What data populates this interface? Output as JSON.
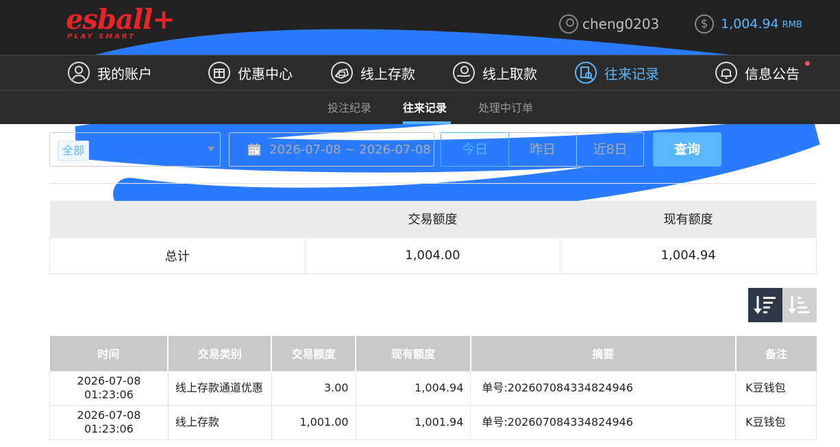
{
  "header": {
    "logo_brand": "esball+",
    "logo_tagline": "PLAY SMART",
    "username": "cheng0203",
    "balance": "1,004.94",
    "currency": "RMB"
  },
  "main_nav": [
    {
      "label": "我的账户",
      "icon": "user-icon"
    },
    {
      "label": "优惠中心",
      "icon": "gift-icon"
    },
    {
      "label": "线上存款",
      "icon": "deposit-icon"
    },
    {
      "label": "线上取款",
      "icon": "withdraw-icon"
    },
    {
      "label": "往来记录",
      "icon": "records-icon",
      "active": true
    },
    {
      "label": "信息公告",
      "icon": "bell-icon"
    }
  ],
  "sub_nav": [
    {
      "label": "投注纪录"
    },
    {
      "label": "往来记录",
      "active": true
    },
    {
      "label": "处理中订单"
    }
  ],
  "filters": {
    "type_selected": "全部",
    "date_range": "2026-07-08 ~ 2026-07-08",
    "ranges": [
      "今日",
      "昨日",
      "近8日"
    ],
    "active_range": "今日",
    "query_label": "查询"
  },
  "summary": {
    "headers": [
      "",
      "交易额度",
      "现有额度"
    ],
    "row": [
      "总计",
      "1,004.00",
      "1,004.94"
    ]
  },
  "records": {
    "headers": [
      "时间",
      "交易类别",
      "交易额度",
      "现有额度",
      "摘要",
      "备注"
    ],
    "rows": [
      [
        "2026-07-08 01:23:06",
        "线上存款通道优惠",
        "3.00",
        "1,004.94",
        "单号:202607084334824946",
        "K豆钱包"
      ],
      [
        "2026-07-08 01:23:06",
        "线上存款",
        "1,001.00",
        "1,001.94",
        "单号:202607084334824946",
        "K豆钱包"
      ]
    ]
  },
  "colors": {
    "accent": "#58b7ff",
    "brand_red": "#e8242b",
    "header_bg": "#222222",
    "notice_dot": "#ff4d6a"
  }
}
